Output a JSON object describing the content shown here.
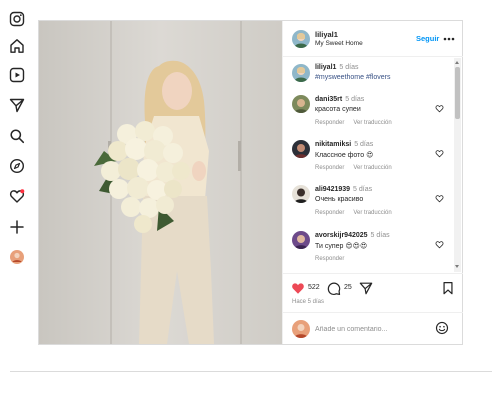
{
  "sidebar": {
    "icons": [
      "instagram-icon",
      "home-icon",
      "reels-icon",
      "direct-icon",
      "search-icon",
      "explore-icon",
      "notifications-icon",
      "create-icon",
      "profile-icon"
    ],
    "notification_dot_color": "#ff3040"
  },
  "post": {
    "header": {
      "username": "liliyal1",
      "location": "My Sweet Home",
      "follow_label": "Seguir",
      "more_icon": "more-horizontal-icon"
    },
    "caption": {
      "username": "liliyal1",
      "time": "5 días",
      "hashtags": "#mysweethome #flovers"
    },
    "comments": [
      {
        "username": "dani35rt",
        "time": "5 días",
        "text": "красота супеи",
        "reply_label": "Responder",
        "translate_label": "Ver traducción"
      },
      {
        "username": "nikitamiksi",
        "time": "5 días",
        "text": "Классное фото 😍",
        "reply_label": "Responder",
        "translate_label": "Ver traducción"
      },
      {
        "username": "ali9421939",
        "time": "5 días",
        "text": "Очень красиво",
        "reply_label": "Responder",
        "translate_label": "Ver traducción"
      },
      {
        "username": "avorskijr942025",
        "time": "5 días",
        "text": "Ти супер 😍😍😍",
        "reply_label": "Responder"
      }
    ],
    "actions": {
      "likes": "522",
      "comments_count": "25",
      "posted": "Hace 5 días",
      "liked": true,
      "like_color": "#ed4956"
    },
    "add_comment": {
      "placeholder": "Añade un comentario...",
      "emoji_icon": "emoji-icon"
    }
  },
  "colors": {
    "link_blue": "#0095f6",
    "hashtag": "#385185",
    "secondary_text": "#8e8e8e",
    "border": "#dbdbdb"
  }
}
